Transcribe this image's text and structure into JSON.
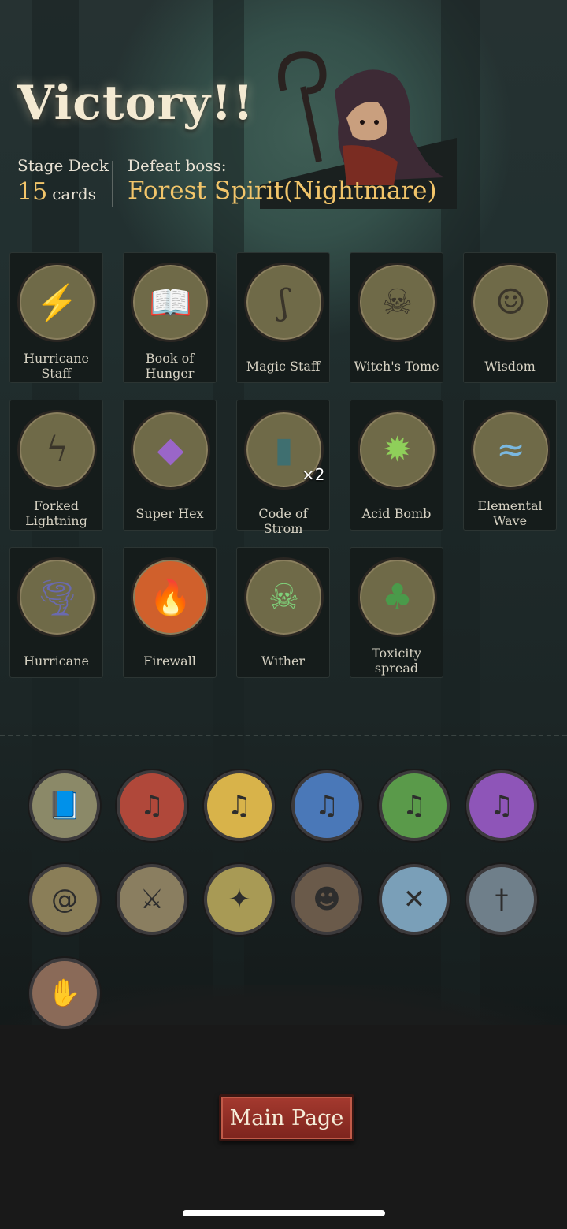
{
  "header": {
    "title": "Victory!!",
    "deck_label": "Stage Deck",
    "deck_count": "15",
    "deck_unit": "cards",
    "boss_label": "Defeat boss:",
    "boss_name": "Forest Spirit(Nightmare)"
  },
  "cards": [
    {
      "name_line1": "Hurricane",
      "name_line2": "Staff",
      "icon": "staff-lightning-icon",
      "color": "#6f6a48"
    },
    {
      "name_line1": "Book of",
      "name_line2": "Hunger",
      "icon": "hunger-book-icon",
      "color": "#706a4a"
    },
    {
      "name_line1": "Magic Staff",
      "name_line2": "",
      "icon": "magic-staff-icon",
      "color": "#6d6747"
    },
    {
      "name_line1": "Witch's Tome",
      "name_line2": "",
      "icon": "skull-tome-icon",
      "color": "#6b6646"
    },
    {
      "name_line1": "Wisdom",
      "name_line2": "",
      "icon": "old-wizard-icon",
      "color": "#716b4b"
    },
    {
      "name_line1": "Forked",
      "name_line2": "Lightning",
      "icon": "lightning-icon",
      "color": "#6a6547"
    },
    {
      "name_line1": "Super Hex",
      "name_line2": "",
      "icon": "purple-crystal-icon",
      "color": "#6e6949"
    },
    {
      "name_line1": "Code of Strom",
      "name_line2": "",
      "icon": "storm-book-icon",
      "color": "#6c6748",
      "count": "×2"
    },
    {
      "name_line1": "Acid Bomb",
      "name_line2": "",
      "icon": "acid-bomb-icon",
      "color": "#6f6a48"
    },
    {
      "name_line1": "Elemental",
      "name_line2": "Wave",
      "icon": "elemental-wave-icon",
      "color": "#6d6848"
    },
    {
      "name_line1": "Hurricane",
      "name_line2": "",
      "icon": "tornado-icon",
      "color": "#6e6948"
    },
    {
      "name_line1": "Firewall",
      "name_line2": "",
      "icon": "fire-wall-icon",
      "color": "#d0602c"
    },
    {
      "name_line1": "Wither",
      "name_line2": "",
      "icon": "withered-skull-icon",
      "color": "#6a6646"
    },
    {
      "name_line1": "Toxicity",
      "name_line2": "spread",
      "icon": "toxic-figure-icon",
      "color": "#6f6a48"
    }
  ],
  "relics": [
    {
      "icon": "spellbook-eyes-icon",
      "color": "#8b8968"
    },
    {
      "icon": "singing-skull-red-icon",
      "color": "#b0483a"
    },
    {
      "icon": "singing-skull-yellow-icon",
      "color": "#d8b34a"
    },
    {
      "icon": "singing-skull-blue-icon",
      "color": "#4a78b8"
    },
    {
      "icon": "singing-skull-green-icon",
      "color": "#5a9a4a"
    },
    {
      "icon": "singing-skull-purple-icon",
      "color": "#8e55b8"
    },
    {
      "icon": "whirlwind-icon",
      "color": "#8a7e58"
    },
    {
      "icon": "sword-slash-icon",
      "color": "#8a7e60"
    },
    {
      "icon": "glowing-book-icon",
      "color": "#a89a55"
    },
    {
      "icon": "vampire-icon",
      "color": "#6a5a4a"
    },
    {
      "icon": "crossed-staffs-icon",
      "color": "#7a9fb8"
    },
    {
      "icon": "dagger-icon",
      "color": "#6f7f8a"
    },
    {
      "icon": "bloody-hands-icon",
      "color": "#8a6a58"
    }
  ],
  "buttons": {
    "main_page": "Main Page"
  }
}
